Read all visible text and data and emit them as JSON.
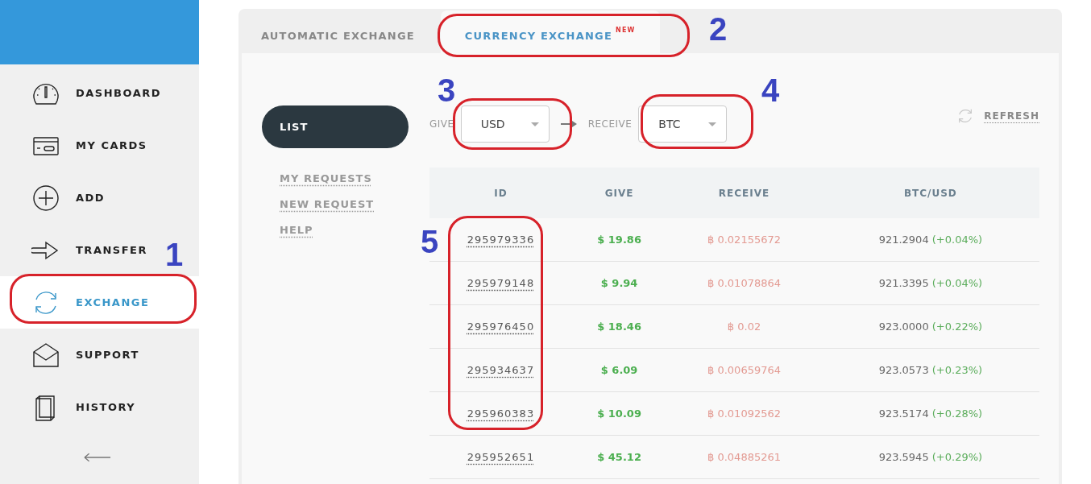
{
  "sidebar": {
    "items": [
      {
        "kind": "gauge",
        "label": "DASHBOARD",
        "selected": false
      },
      {
        "kind": "card",
        "label": "MY CARDS",
        "selected": false
      },
      {
        "kind": "plus",
        "label": "ADD",
        "selected": false
      },
      {
        "kind": "arrow",
        "label": "TRANSFER",
        "selected": false
      },
      {
        "kind": "cycle",
        "label": "EXCHANGE",
        "selected": true
      },
      {
        "kind": "envelope",
        "label": "SUPPORT",
        "selected": false
      },
      {
        "kind": "book",
        "label": "HISTORY",
        "selected": false
      }
    ]
  },
  "tabs": [
    {
      "label": "AUTOMATIC EXCHANGE",
      "selected": false
    },
    {
      "label": "CURRENCY EXCHANGE",
      "badge": "NEW",
      "selected": true
    }
  ],
  "sub_nav": [
    {
      "label": "LIST",
      "selected": true
    },
    {
      "label": "MY REQUESTS",
      "selected": false
    },
    {
      "label": "NEW REQUEST",
      "selected": false
    },
    {
      "label": "HELP",
      "selected": false
    }
  ],
  "filters": {
    "give": {
      "label": "GIVE",
      "value": "USD"
    },
    "receive": {
      "label": "RECEIVE",
      "value": "BTC"
    },
    "refresh": "REFRESH"
  },
  "table": {
    "columns": [
      "ID",
      "GIVE",
      "RECEIVE",
      "BTC/USD"
    ],
    "rows": [
      {
        "id": "295979336",
        "give": "$ 19.86",
        "receive": "฿ 0.02155672",
        "rate": "921.2904",
        "change": "(+0.04%)"
      },
      {
        "id": "295979148",
        "give": "$ 9.94",
        "receive": "฿ 0.01078864",
        "rate": "921.3395",
        "change": "(+0.04%)"
      },
      {
        "id": "295976450",
        "give": "$ 18.46",
        "receive": "฿ 0.02",
        "rate": "923.0000",
        "change": "(+0.22%)"
      },
      {
        "id": "295934637",
        "give": "$ 6.09",
        "receive": "฿ 0.00659764",
        "rate": "923.0573",
        "change": "(+0.23%)"
      },
      {
        "id": "295960383",
        "give": "$ 10.09",
        "receive": "฿ 0.01092562",
        "rate": "923.5174",
        "change": "(+0.28%)"
      },
      {
        "id": "295952651",
        "give": "$ 45.12",
        "receive": "฿ 0.04885261",
        "rate": "923.5945",
        "change": "(+0.29%)"
      }
    ]
  },
  "annotations": [
    {
      "number": "1",
      "kind": "sidebar"
    },
    {
      "number": "2",
      "kind": "tab"
    },
    {
      "number": "3",
      "kind": "give"
    },
    {
      "number": "4",
      "kind": "receive"
    },
    {
      "number": "5",
      "kind": "ids"
    }
  ]
}
